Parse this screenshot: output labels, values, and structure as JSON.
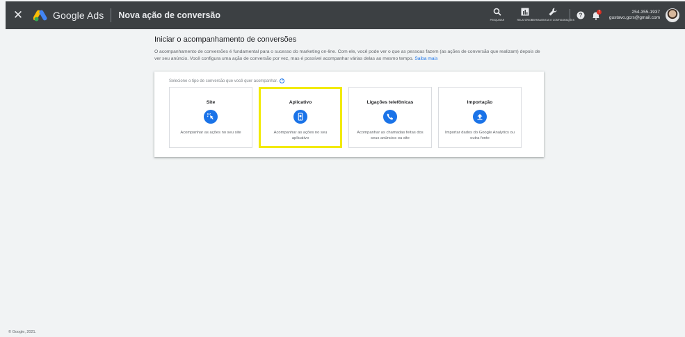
{
  "topbar": {
    "close_glyph": "✕",
    "brand": "Google Ads",
    "page_title": "Nova ação de conversão",
    "tools": [
      {
        "label": "PESQUISAR",
        "icon": "search-icon"
      },
      {
        "label": "RELATÓRIOS",
        "icon": "reports-icon"
      },
      {
        "label": "FERRAMENTAS E CONFIGURAÇÕES",
        "icon": "wrench-icon"
      }
    ],
    "help_icon": "help-icon",
    "notification_icon": "bell-icon",
    "notification_badge": "!",
    "account_phone": "254-355-1937",
    "account_email": "gustavo.gcrs@gmail.com"
  },
  "main": {
    "title": "Iniciar o acompanhamento de conversões",
    "description": "O acompanhamento de conversões é fundamental para o sucesso do marketing on-line. Com ele, você pode ver o que as pessoas fazem (as ações de conversão que realizam) depois de ver seu anúncio. Você configura uma ação de conversão por vez, mas é possível acompanhar várias delas ao mesmo tempo.",
    "learn_more": "Saiba mais",
    "prompt": "Selecione o tipo de conversão que você quer acompanhar.",
    "options": [
      {
        "title": "Site",
        "icon": "website-click-icon",
        "description": "Acompanhar as ações no seu site"
      },
      {
        "title": "Aplicativo",
        "icon": "mobile-app-icon",
        "description": "Acompanhar as ações no seu aplicativo"
      },
      {
        "title": "Ligações telefônicas",
        "icon": "phone-icon",
        "description": "Acompanhar as chamadas feitas dos seus anúncios ou site"
      },
      {
        "title": "Importação",
        "icon": "upload-icon",
        "description": "Importar dados do Google Analytics ou outra fonte"
      }
    ],
    "selected_option": "Aplicativo"
  },
  "footer": {
    "copyright": "© Google, 2021."
  },
  "colors": {
    "topbar": "#3c4043",
    "accent": "#1a73e8",
    "highlight": "#f2ea00",
    "background": "#f1f3f4"
  }
}
